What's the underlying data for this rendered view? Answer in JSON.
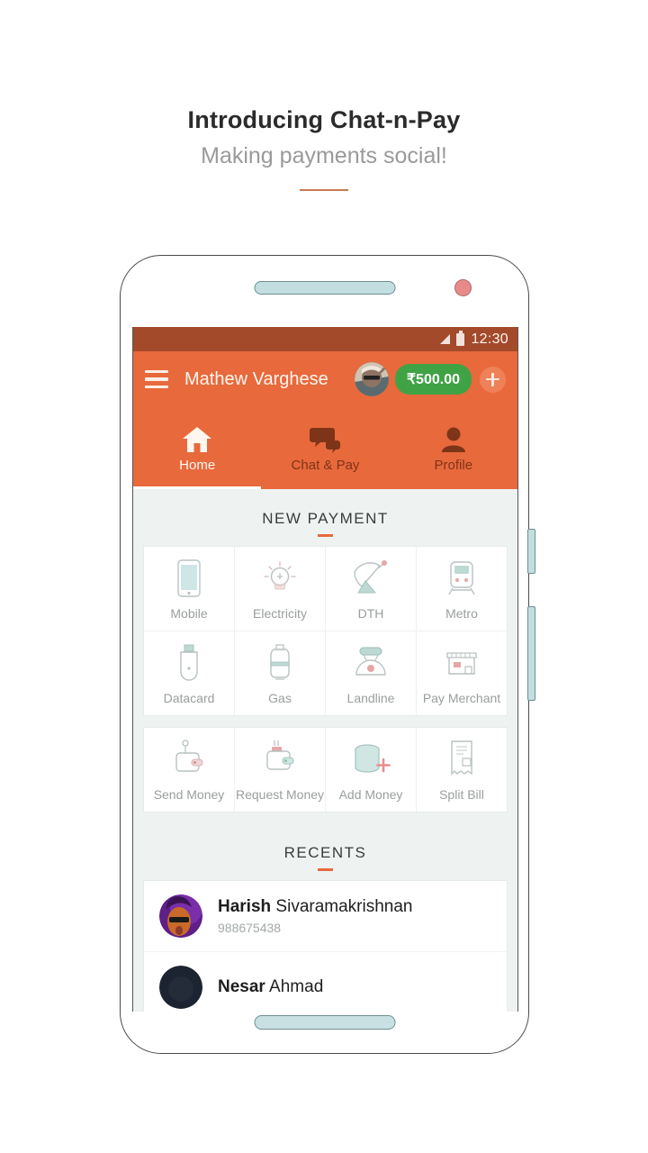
{
  "promo": {
    "title": "Introducing Chat-n-Pay",
    "subtitle": "Making payments social!"
  },
  "colors": {
    "accent_orange": "#e8693c",
    "statusbar_orange": "#a34a2b",
    "balance_green": "#3fa345",
    "screen_bg": "#eef3f2",
    "rule": "#c97b52"
  },
  "statusbar": {
    "time": "12:30",
    "signal_icon": "signal-bars-icon",
    "battery_icon": "battery-icon"
  },
  "appbar": {
    "menu_icon": "hamburger-menu-icon",
    "user_name": "Mathew Varghese",
    "avatar_icon": "user-avatar",
    "balance": "₹500.00",
    "add_icon": "plus-icon"
  },
  "tabs": [
    {
      "label": "Home",
      "icon": "home-icon",
      "active": true
    },
    {
      "label": "Chat & Pay",
      "icon": "chat-bubbles-icon",
      "active": false
    },
    {
      "label": "Profile",
      "icon": "person-icon",
      "active": false
    }
  ],
  "new_payment": {
    "heading": "NEW PAYMENT",
    "rows": [
      [
        {
          "label": "Mobile",
          "icon": "smartphone-icon"
        },
        {
          "label": "Electricity",
          "icon": "lightbulb-icon"
        },
        {
          "label": "DTH",
          "icon": "satellite-dish-icon"
        },
        {
          "label": "Metro",
          "icon": "metro-train-icon"
        }
      ],
      [
        {
          "label": "Datacard",
          "icon": "usb-dongle-icon"
        },
        {
          "label": "Gas",
          "icon": "gas-cylinder-icon"
        },
        {
          "label": "Landline",
          "icon": "telephone-icon"
        },
        {
          "label": "Pay Merchant",
          "icon": "shop-icon"
        }
      ]
    ],
    "money_row": [
      {
        "label": "Send Money",
        "icon": "wallet-send-icon"
      },
      {
        "label": "Request Money",
        "icon": "wallet-request-icon"
      },
      {
        "label": "Add Money",
        "icon": "coins-plus-icon"
      },
      {
        "label": "Split Bill",
        "icon": "receipt-icon"
      }
    ]
  },
  "recents": {
    "heading": "RECENTS",
    "items": [
      {
        "first_name": "Harish",
        "last_name": " Sivaramakrishnan",
        "number": "988675438",
        "avatar": "contact-avatar-purple"
      },
      {
        "first_name": "Nesar",
        "last_name": " Ahmad",
        "number": "",
        "avatar": "contact-avatar-dark"
      }
    ]
  }
}
